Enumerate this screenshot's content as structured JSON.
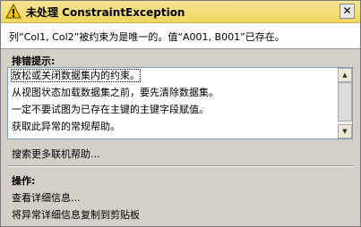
{
  "dialog": {
    "title": "未处理 ConstraintException",
    "close_glyph": "✕",
    "message": "列“Col1, Col2”被约束为是唯一的。值“A001, B001”已存在。"
  },
  "tips": {
    "header": "排错提示:",
    "items": [
      "放松或关闭数据集内的约束。",
      "从视图状态加载数据集之前，要先清除数据集。",
      "一定不要试图为已存在主键的主键字段赋值。",
      "获取此异常的常规帮助。"
    ],
    "more_help_link": "搜索更多联机帮助..."
  },
  "actions": {
    "header": "操作:",
    "view_details": "查看详细信息...",
    "copy_details": "将异常详细信息复制到剪贴板"
  },
  "colors": {
    "title_bar": "#f0d65e",
    "warning_icon": "#f5c400",
    "dialog_bg": "#d4d0c8"
  },
  "icons": {
    "title": "warning-triangle-icon",
    "scroll_up": "scroll-up-arrow-icon",
    "scroll_down": "scroll-down-arrow-icon"
  }
}
